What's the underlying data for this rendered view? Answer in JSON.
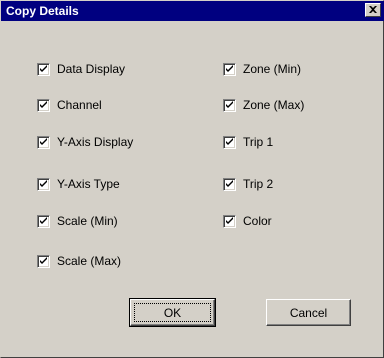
{
  "window": {
    "title": "Copy Details",
    "close_glyph": "×"
  },
  "options_left": [
    {
      "label": "Data Display",
      "checked": true
    },
    {
      "label": "Channel",
      "checked": true
    },
    {
      "label": "Y-Axis Display",
      "checked": true
    },
    {
      "label": "Y-Axis Type",
      "checked": true
    },
    {
      "label": "Scale (Min)",
      "checked": true
    },
    {
      "label": "Scale (Max)",
      "checked": true
    }
  ],
  "options_right": [
    {
      "label": "Zone (Min)",
      "checked": true
    },
    {
      "label": "Zone (Max)",
      "checked": true
    },
    {
      "label": "Trip 1",
      "checked": true
    },
    {
      "label": "Trip 2",
      "checked": true
    },
    {
      "label": "Color",
      "checked": true
    }
  ],
  "buttons": {
    "ok_label": "OK",
    "cancel_label": "Cancel"
  },
  "colors": {
    "titlebar": "#000080",
    "face": "#d4d0c8"
  },
  "icons": {
    "close": "close-icon",
    "check": "checkmark-icon"
  }
}
